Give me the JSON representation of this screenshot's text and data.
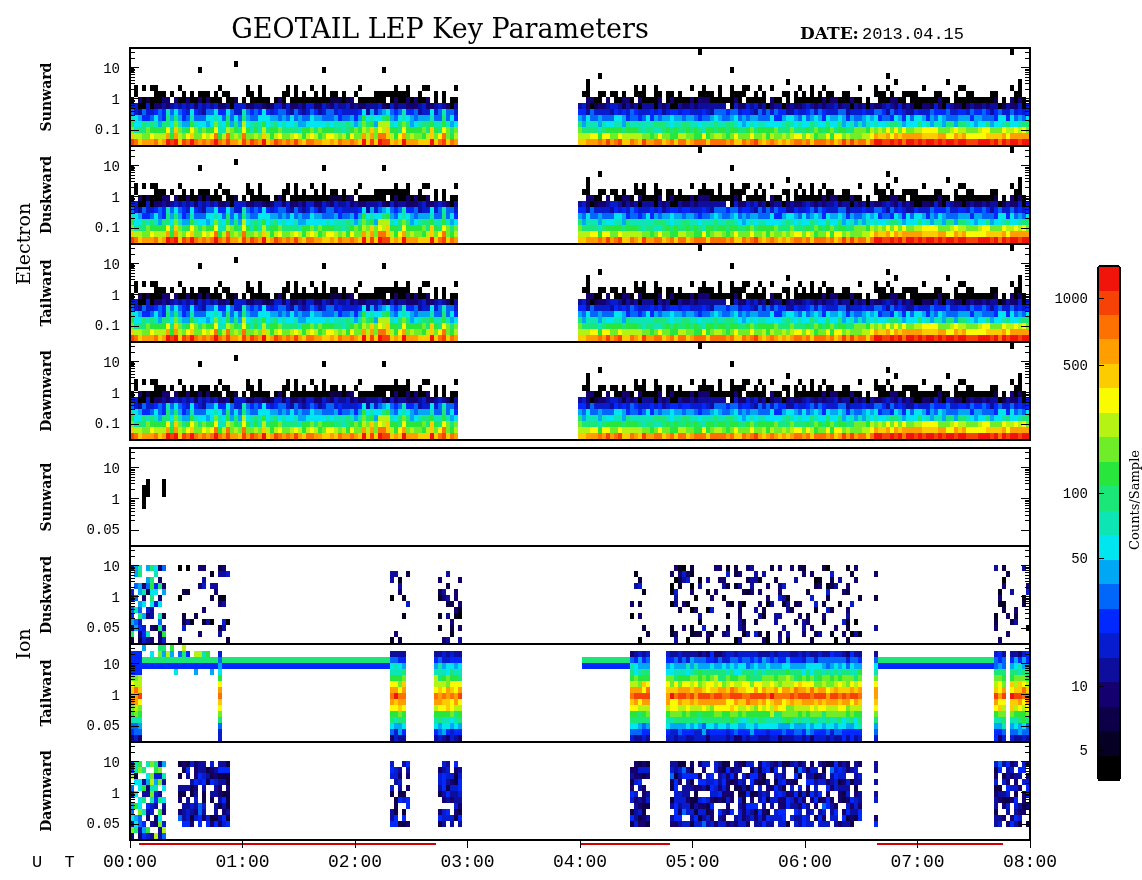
{
  "title": "GEOTAIL LEP Key Parameters",
  "date": {
    "label": "DATE:",
    "value": "2013.04.15"
  },
  "groups": [
    {
      "label": "Electron",
      "panels": [
        {
          "label": "Sunward",
          "kind": "electron",
          "yticks": [
            "10",
            "1",
            "0.1"
          ]
        },
        {
          "label": "Duskward",
          "kind": "electron",
          "yticks": [
            "10",
            "1",
            "0.1"
          ]
        },
        {
          "label": "Tailward",
          "kind": "electron",
          "yticks": [
            "10",
            "1",
            "0.1"
          ]
        },
        {
          "label": "Dawnward",
          "kind": "electron",
          "yticks": [
            "10",
            "1",
            "0.1"
          ]
        }
      ]
    },
    {
      "label": "Ion",
      "panels": [
        {
          "label": "Sunward",
          "kind": "ion-sparse",
          "yticks": [
            "10",
            "1",
            "0.05"
          ]
        },
        {
          "label": "Duskward",
          "kind": "ion-scatter",
          "yticks": [
            "10",
            "1",
            "0.05"
          ]
        },
        {
          "label": "Tailward",
          "kind": "ion-tail",
          "yticks": [
            "10",
            "1",
            "0.05"
          ]
        },
        {
          "label": "Dawnward",
          "kind": "ion-dense",
          "yticks": [
            "10",
            "1",
            "0.05"
          ]
        }
      ]
    }
  ],
  "colorbar": {
    "title": "Counts/Sample",
    "ticks": [
      "1000",
      "500",
      "100",
      "50",
      "10",
      "5"
    ]
  },
  "x_axis": {
    "label": "U T",
    "ticks": [
      "00:00",
      "01:00",
      "02:00",
      "03:00",
      "04:00",
      "05:00",
      "06:00",
      "07:00",
      "08:00"
    ]
  }
}
